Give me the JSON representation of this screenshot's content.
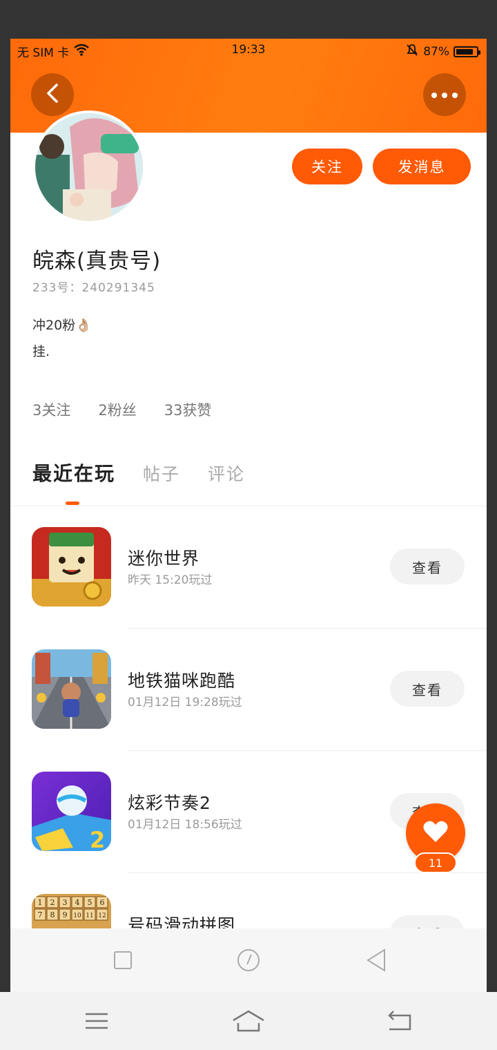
{
  "status_bar": {
    "carrier": "无 SIM 卡",
    "time": "19:33",
    "battery": "87%",
    "battery_level": 0.87
  },
  "header": {
    "back_icon": "chevron-left-icon",
    "more_icon": "more-dots-icon",
    "accent_color": "#ff5a06"
  },
  "profile": {
    "name": "皖森(真贵号)",
    "uid": "233号：240291345",
    "bio_line1": "冲20粉👌🏼",
    "bio_line2": "挂.",
    "follow_label": "关注",
    "message_label": "发消息"
  },
  "stats": {
    "following": "3关注",
    "fans": "2粉丝",
    "likes": "33获赞"
  },
  "tabs": [
    {
      "label": "最近在玩"
    },
    {
      "label": "帖子"
    },
    {
      "label": "评论"
    }
  ],
  "games": [
    {
      "title": "迷你世界",
      "time": "昨天 15:20玩过",
      "button": "查看",
      "icon": "game-mini-world-icon"
    },
    {
      "title": "地铁猫咪跑酷",
      "time": "01月12日 19:28玩过",
      "button": "查看",
      "icon": "game-subway-cat-icon"
    },
    {
      "title": "炫彩节奏2",
      "time": "01月12日 18:56玩过",
      "button": "查看",
      "icon": "game-rhythm-icon"
    },
    {
      "title": "号码滑动拼图",
      "time": "",
      "button": "查看",
      "icon": "game-number-puzzle-icon"
    }
  ],
  "puzzle_numbers": [
    "1",
    "2",
    "3",
    "4",
    "5",
    "6",
    "7",
    "8",
    "9",
    "10",
    "11",
    "12"
  ],
  "rhythm_badge": "2",
  "fab": {
    "icon": "heart-icon",
    "count": "11"
  },
  "system_nav": {
    "inner": [
      "recent-apps-icon",
      "home-circle-icon",
      "back-triangle-icon"
    ],
    "outer": [
      "menu-lines-icon",
      "home-house-icon",
      "return-icon"
    ]
  }
}
